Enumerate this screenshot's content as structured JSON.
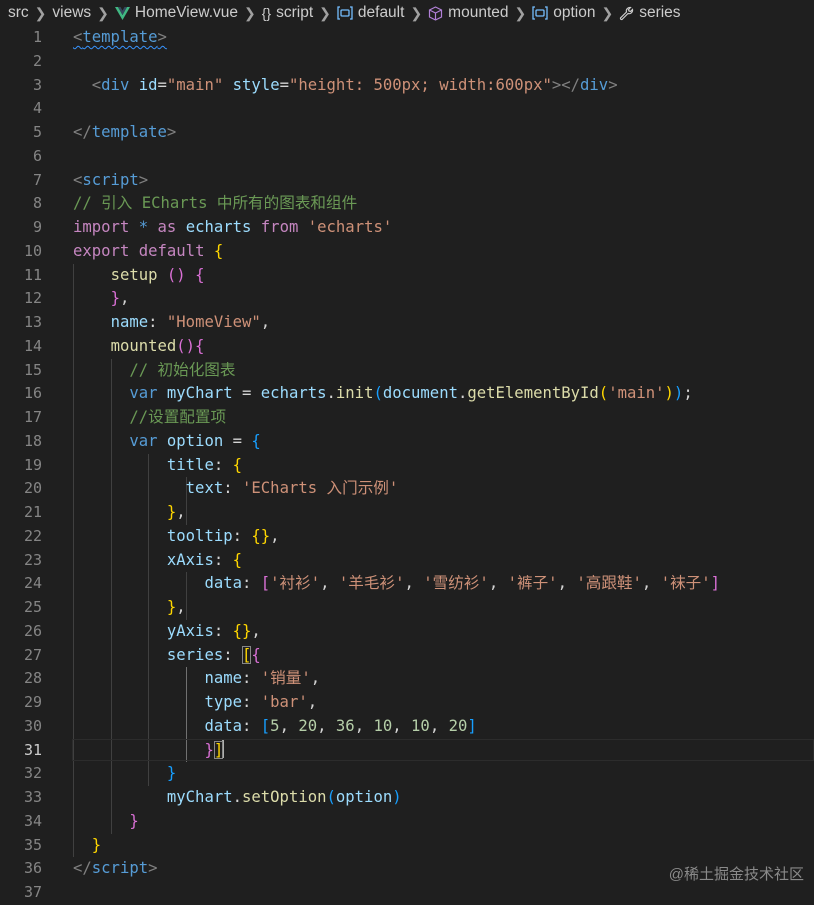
{
  "breadcrumb": [
    "src",
    "views",
    "HomeView.vue",
    "script",
    "default",
    "mounted",
    "option",
    "series"
  ],
  "code": {
    "l1_open": "<",
    "l1_tag": "template",
    "l1_close": ">",
    "l3_div": "div",
    "l3_id": "id",
    "l3_idv": "\"main\"",
    "l3_style": "style",
    "l3_stylev": "\"height: 500px; width:600px\"",
    "l5_close": "template",
    "l7_tag": "script",
    "l8": "// 引入 ECharts 中所有的图表和组件",
    "l9_import": "import",
    "l9_as": "as",
    "l9_echarts": "echarts",
    "l9_from": "from",
    "l9_str": "'echarts'",
    "l10_export": "export",
    "l10_default": "default",
    "l11_setup": "setup",
    "l13_name": "name",
    "l13_val": "\"HomeView\"",
    "l14_mounted": "mounted",
    "l15": "// 初始化图表",
    "l16_var": "var",
    "l16_mychart": "myChart",
    "l16_echarts": "echarts",
    "l16_init": "init",
    "l16_document": "document",
    "l16_get": "getElementById",
    "l16_str": "'main'",
    "l17": "//设置配置项",
    "l18_option": "option",
    "l19_title": "title",
    "l20_text": "text",
    "l20_val": "'ECharts 入门示例'",
    "l22_tooltip": "tooltip",
    "l23_xaxis": "xAxis",
    "l24_data": "data",
    "l24_items": [
      "'衬衫'",
      "'羊毛衫'",
      "'雪纺衫'",
      "'裤子'",
      "'高跟鞋'",
      "'袜子'"
    ],
    "l26_yaxis": "yAxis",
    "l27_series": "series",
    "l28_name": "name",
    "l28_val": "'销量'",
    "l29_type": "type",
    "l29_val": "'bar'",
    "l30_data": "data",
    "l30_nums": [
      "5",
      "20",
      "36",
      "10",
      "10",
      "20"
    ],
    "l33_mychart": "myChart",
    "l33_setoption": "setOption",
    "l33_option": "option",
    "l36_script": "script"
  },
  "line_numbers": [
    "1",
    "2",
    "3",
    "4",
    "5",
    "6",
    "7",
    "8",
    "9",
    "10",
    "11",
    "12",
    "13",
    "14",
    "15",
    "16",
    "17",
    "18",
    "19",
    "20",
    "21",
    "22",
    "23",
    "24",
    "25",
    "26",
    "27",
    "28",
    "29",
    "30",
    "31",
    "32",
    "33",
    "34",
    "35",
    "36",
    "37"
  ],
  "active_line": "31",
  "watermark": "@稀土掘金技术社区",
  "colors": {
    "background": "#1f1f1f",
    "keyword_blue": "#569cd6",
    "string": "#ce9178",
    "comment": "#6a9955",
    "variable": "#9cdcfe",
    "function": "#dcdcaa",
    "number": "#b5cea8",
    "control_keyword": "#c586c0",
    "bracket_gold": "#ffd700",
    "bracket_orchid": "#da70d6",
    "bracket_blue": "#179fff"
  }
}
